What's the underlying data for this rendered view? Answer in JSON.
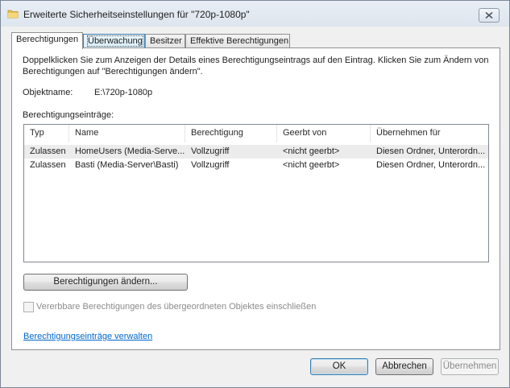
{
  "window": {
    "title": "Erweiterte Sicherheitseinstellungen für \"720p-1080p\""
  },
  "tabs": [
    {
      "label": "Berechtigungen"
    },
    {
      "label": "Überwachung"
    },
    {
      "label": "Besitzer"
    },
    {
      "label": "Effektive Berechtigungen"
    }
  ],
  "permissions": {
    "intro": "Doppelklicken Sie zum Anzeigen der Details eines Berechtigungseintrags auf den Eintrag. Klicken Sie zum Ändern von Berechtigungen auf \"Berechtigungen ändern\".",
    "object_name_label": "Objektname:",
    "object_name_value": "E:\\720p-1080p",
    "entries_label": "Berechtigungseinträge:",
    "columns": [
      "Typ",
      "Name",
      "Berechtigung",
      "Geerbt von",
      "Übernehmen für"
    ],
    "rows": [
      {
        "typ": "Zulassen",
        "name": "HomeUsers (Media-Serve...",
        "berechtigung": "Vollzugriff",
        "geerbt": "<nicht geerbt>",
        "uebernehmen": "Diesen Ordner, Unterordn..."
      },
      {
        "typ": "Zulassen",
        "name": "Basti (Media-Server\\Basti)",
        "berechtigung": "Vollzugriff",
        "geerbt": "<nicht geerbt>",
        "uebernehmen": "Diesen Ordner, Unterordn..."
      }
    ],
    "change_button": "Berechtigungen ändern...",
    "inherit_checkbox": {
      "label": "Vererbbare Berechtigungen des übergeordneten Objektes einschließen",
      "checked": false
    },
    "manage_link": "Berechtigungseinträge verwalten"
  },
  "footer": {
    "ok": "OK",
    "cancel": "Abbrechen",
    "apply": "Übernehmen"
  },
  "icons": {
    "title": "folder-icon",
    "close": "close-icon"
  }
}
